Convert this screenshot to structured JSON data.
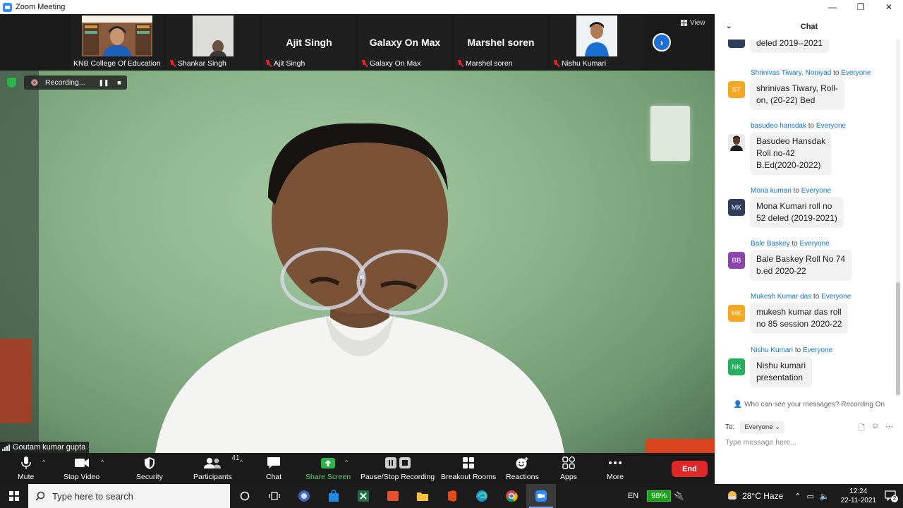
{
  "window": {
    "title": "Zoom Meeting",
    "controls": [
      "—",
      "❐",
      "✕"
    ]
  },
  "strip": {
    "tiles": [
      {
        "id": "knb",
        "big": "",
        "small": "KNB College Of Education",
        "muted": false,
        "photo": true
      },
      {
        "id": "shankar",
        "big": "",
        "small": "Shankar Singh",
        "muted": true,
        "photo": true
      },
      {
        "id": "ajit",
        "big": "Ajit Singh",
        "small": "Ajit Singh",
        "muted": true,
        "photo": false
      },
      {
        "id": "galaxy",
        "big": "Galaxy On Max",
        "small": "Galaxy On Max",
        "muted": true,
        "photo": false
      },
      {
        "id": "marshel",
        "big": "Marshel soren",
        "small": "Marshel soren",
        "muted": true,
        "photo": false
      },
      {
        "id": "nishu",
        "big": "",
        "small": "Nishu Kumari",
        "muted": true,
        "photo": true
      }
    ],
    "view_label": "View",
    "next_glyph": "›"
  },
  "main": {
    "recording_label": "Recording...",
    "pause_glyph": "❚❚",
    "stop_glyph": "■",
    "speaker_name": "Goutam kumar gupta"
  },
  "toolbar": {
    "mute": "Mute",
    "stop_video": "Stop Video",
    "security": "Security",
    "participants": "Participants",
    "participants_count": "41",
    "chat": "Chat",
    "share_screen": "Share Screen",
    "pause_stop": "Pause/Stop Recording",
    "breakout": "Breakout Rooms",
    "reactions": "Reactions",
    "apps": "Apps",
    "more": "More",
    "end": "End",
    "caret": "^"
  },
  "chat": {
    "title": "Chat",
    "collapse_glyph": "⌄",
    "to_word": "to",
    "everyone": "Everyone",
    "messages": [
      {
        "sender": "",
        "initials": "",
        "color": "#2e3d5c",
        "lines": [
          "deled 2019--2021"
        ]
      },
      {
        "sender": "Shrinivas Tiwary, Noniyad",
        "initials": "ST",
        "color": "#f5a623",
        "lines": [
          "shrinivas Tiwary, Roll-",
          "on, (20-22) Bed"
        ]
      },
      {
        "sender": "basudeo hansdak",
        "initials": "",
        "color": "#3b3b3b",
        "lines": [
          "Basudeo Hansdak",
          "Roll no-42",
          "B.Ed(2020-2022)"
        ]
      },
      {
        "sender": "Mona kumari",
        "initials": "MK",
        "color": "#2e3d5c",
        "lines": [
          "Mona Kumari roll no",
          "52 deled (2019-2021)"
        ]
      },
      {
        "sender": "Bale Baskey",
        "initials": "BB",
        "color": "#8e44ad",
        "lines": [
          "Bale Baskey Roll No 74",
          "b.ed 2020-22"
        ]
      },
      {
        "sender": "Mukesh Kumar das",
        "initials": "MK",
        "color": "#f5a623",
        "lines": [
          "mukesh kumar das roll",
          "no 85 session 2020-22"
        ]
      },
      {
        "sender": "Nishu Kumari",
        "initials": "NK",
        "color": "#27ae60",
        "lines": [
          "Nishu kumari",
          "presentation"
        ]
      }
    ],
    "who_can_see": "Who can see your messages? Recording On",
    "to_label": "To:",
    "to_value": "Everyone",
    "placeholder": "Type message here..."
  },
  "taskbar": {
    "search_placeholder": "Type here to search",
    "lang": "EN",
    "battery": "98%",
    "weather": "28°C  Haze",
    "time": "12:24",
    "date": "22-11-2021",
    "notif_count": "2"
  }
}
